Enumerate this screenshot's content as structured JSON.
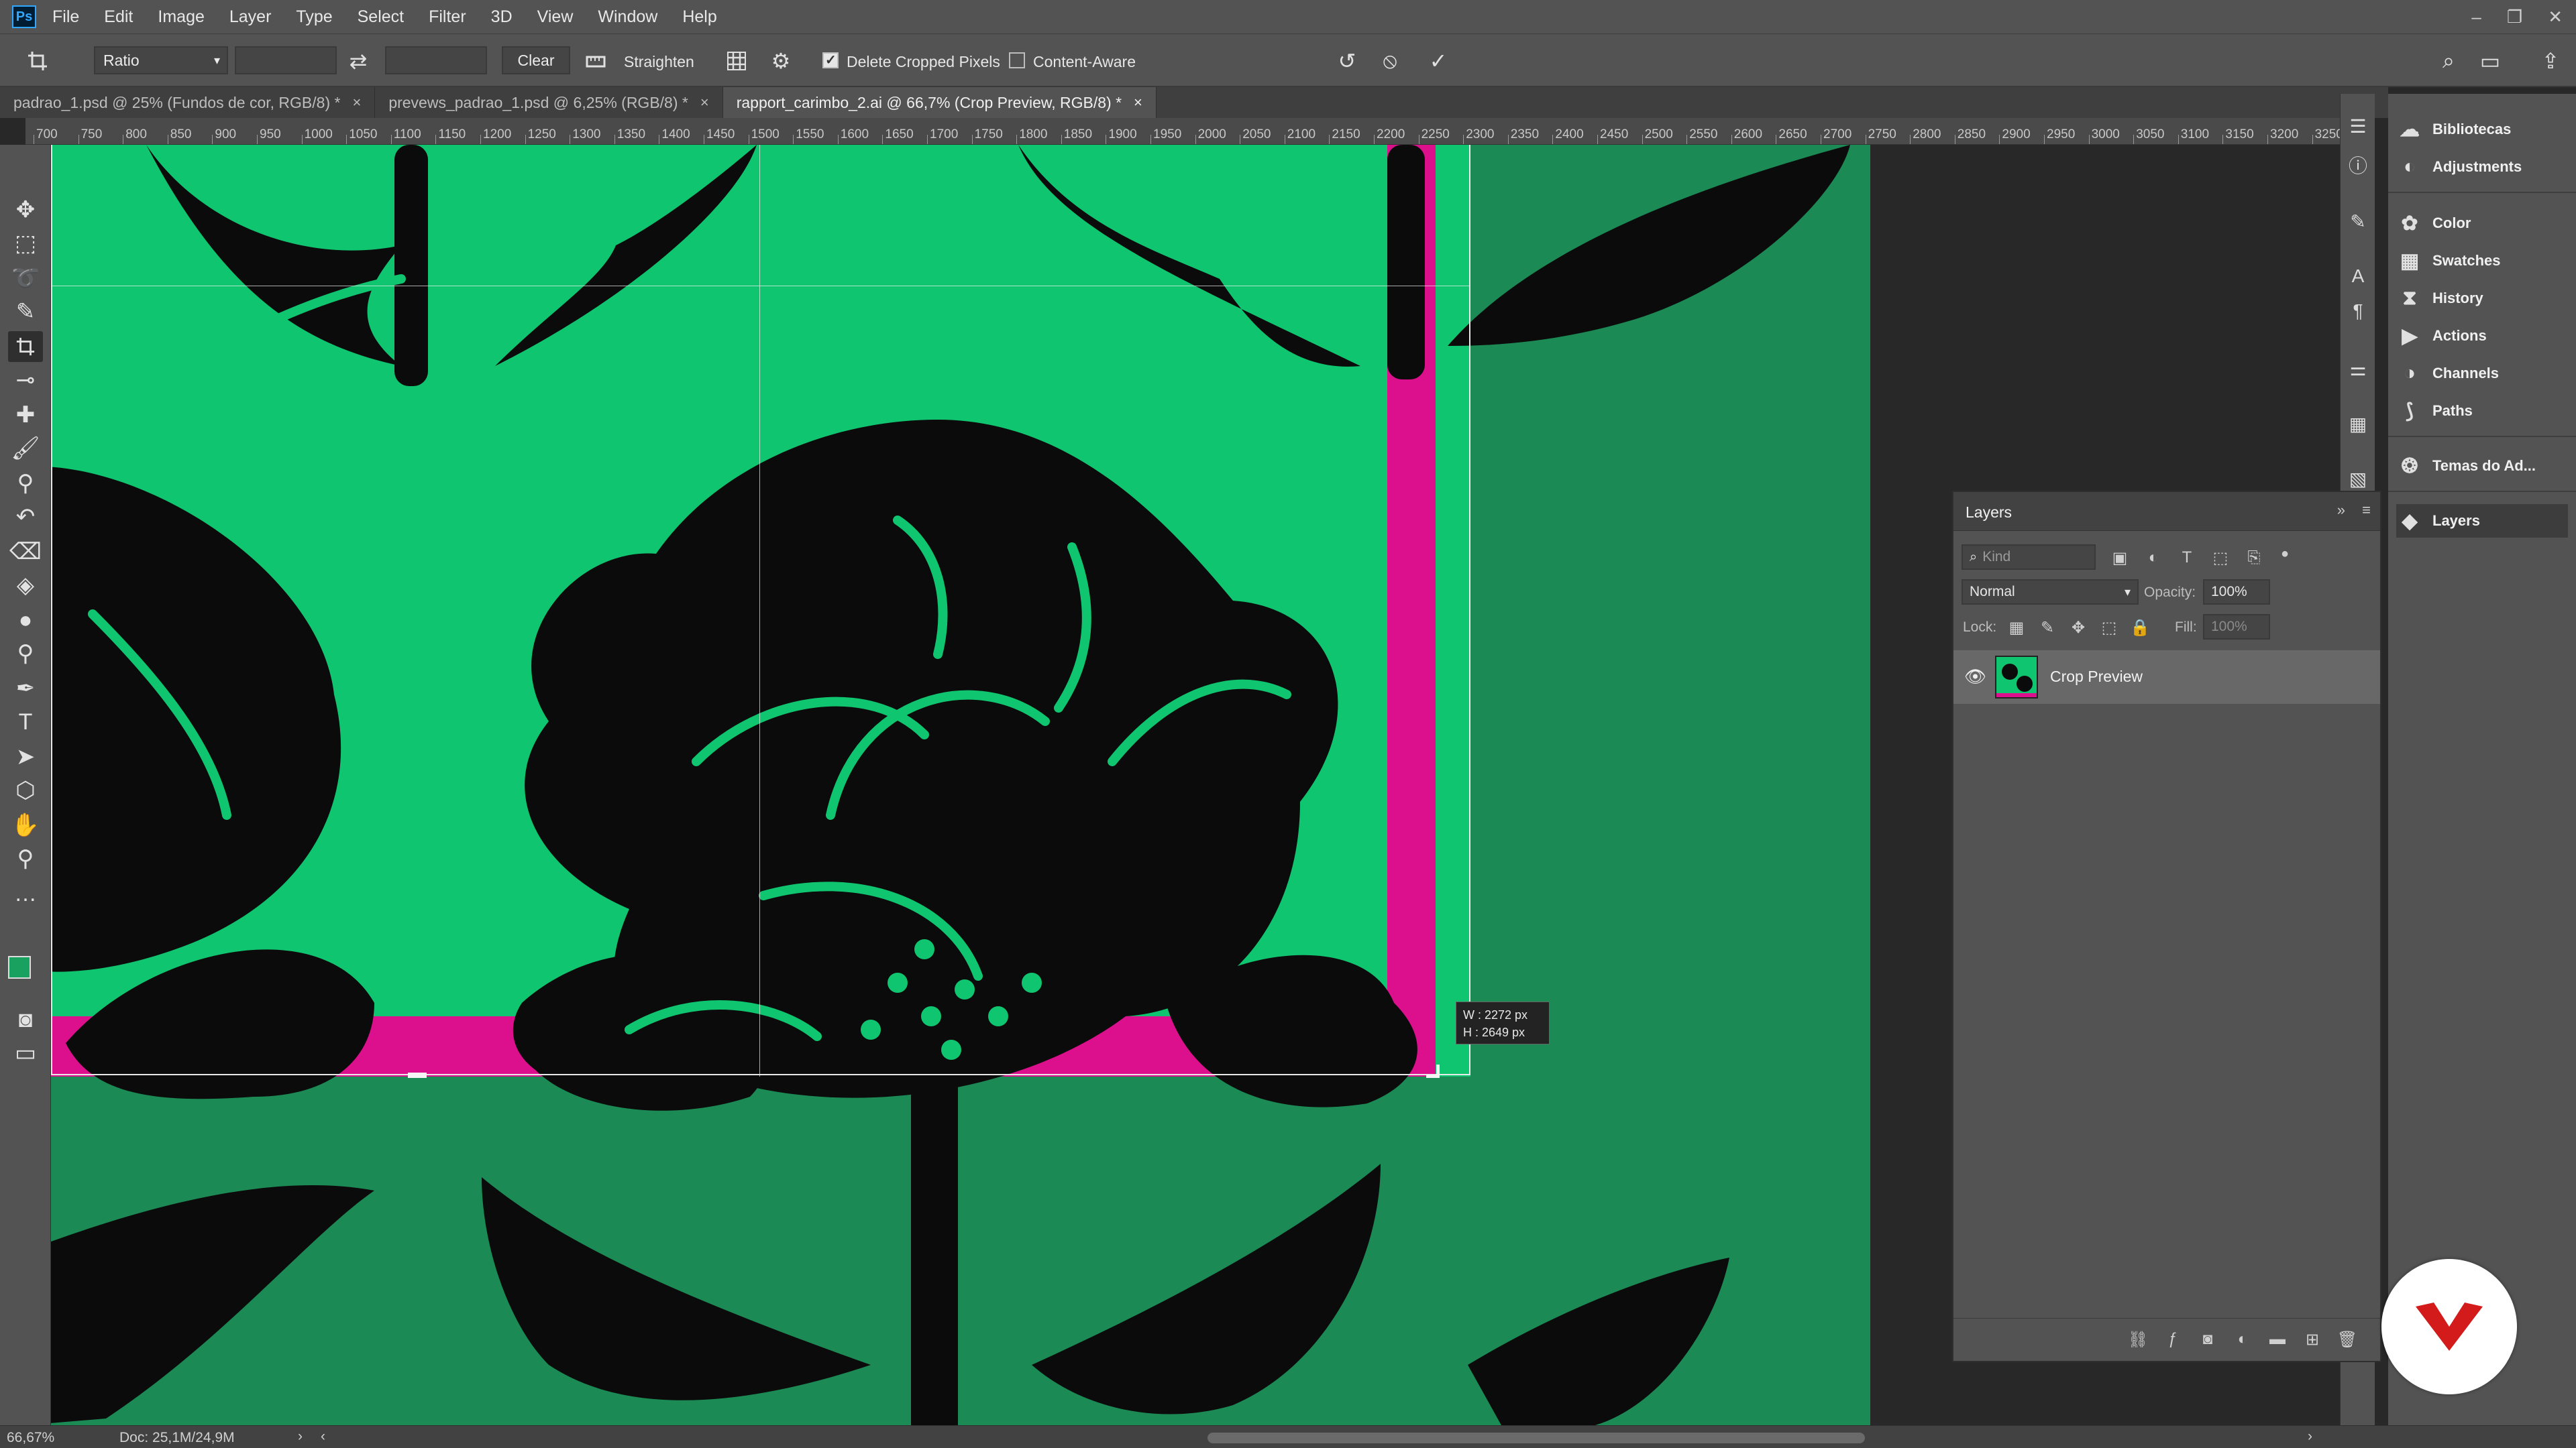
{
  "app": {
    "logo": "Ps"
  },
  "menu": [
    "File",
    "Edit",
    "Image",
    "Layer",
    "Type",
    "Select",
    "Filter",
    "3D",
    "View",
    "Window",
    "Help"
  ],
  "window_controls": {
    "minimize": "–",
    "restore": "❐",
    "close": "✕"
  },
  "options_bar": {
    "ratio_value": "Ratio",
    "swap_icon": "⇄",
    "clear_label": "Clear",
    "straighten_label": "Straighten",
    "delete_cropped_label": "Delete Cropped Pixels",
    "delete_cropped_checked": true,
    "content_aware_label": "Content-Aware",
    "content_aware_checked": false
  },
  "tabs": [
    {
      "label": "padrao_1.psd @ 25% (Fundos de cor, RGB/8) *",
      "active": false
    },
    {
      "label": "prevews_padrao_1.psd @ 6,25% (RGB/8) *",
      "active": false
    },
    {
      "label": "rapport_carimbo_2.ai @ 66,7% (Crop Preview, RGB/8) *",
      "active": true
    }
  ],
  "ruler_ticks": [
    "700",
    "750",
    "800",
    "850",
    "900",
    "950",
    "1000",
    "1050",
    "1100",
    "1150",
    "1200",
    "1250",
    "1300",
    "1350",
    "1400",
    "1450",
    "1500",
    "1550",
    "1600",
    "1650",
    "1700",
    "1750",
    "1800",
    "1850",
    "1900",
    "1950",
    "2000",
    "2050",
    "2100",
    "2150",
    "2200",
    "2250",
    "2300",
    "2350",
    "2400",
    "2450",
    "2500",
    "2550",
    "2600",
    "2650",
    "2700",
    "2750",
    "2800",
    "2850",
    "2900",
    "2950",
    "3000",
    "3050",
    "3100",
    "3150",
    "3200",
    "3250"
  ],
  "crop_tooltip": {
    "w": "W :  2272 px",
    "h": "H :  2649 px"
  },
  "right_panels": [
    {
      "label": "Bibliotecas",
      "icon": "cloud-libraries-icon"
    },
    {
      "label": "Adjustments",
      "icon": "adjustments-icon"
    },
    {
      "label": "Color",
      "icon": "color-icon"
    },
    {
      "label": "Swatches",
      "icon": "swatches-icon"
    },
    {
      "label": "History",
      "icon": "history-icon"
    },
    {
      "label": "Actions",
      "icon": "actions-icon"
    },
    {
      "label": "Channels",
      "icon": "channels-icon"
    },
    {
      "label": "Paths",
      "icon": "paths-icon"
    },
    {
      "label": "Temas do Ad...",
      "icon": "themes-icon"
    },
    {
      "label": "Layers",
      "icon": "layers-icon"
    }
  ],
  "layers_panel": {
    "title": "Layers",
    "kind_placeholder": "Kind",
    "blend_mode": "Normal",
    "opacity_label": "Opacity:",
    "opacity_value": "100%",
    "lock_label": "Lock:",
    "fill_label": "Fill:",
    "fill_value": "100%",
    "layers": [
      {
        "name": "Crop Preview",
        "visible": true
      }
    ]
  },
  "status": {
    "zoom": "66,67%",
    "doc": "Doc: 25,1M/24,9M"
  },
  "colors": {
    "artwork_bg": "#1b8a55",
    "crop_green": "#0fc56f",
    "magenta": "#dc0f8d",
    "ink": "#0b0b0b",
    "watermark": "#d31b1b"
  }
}
